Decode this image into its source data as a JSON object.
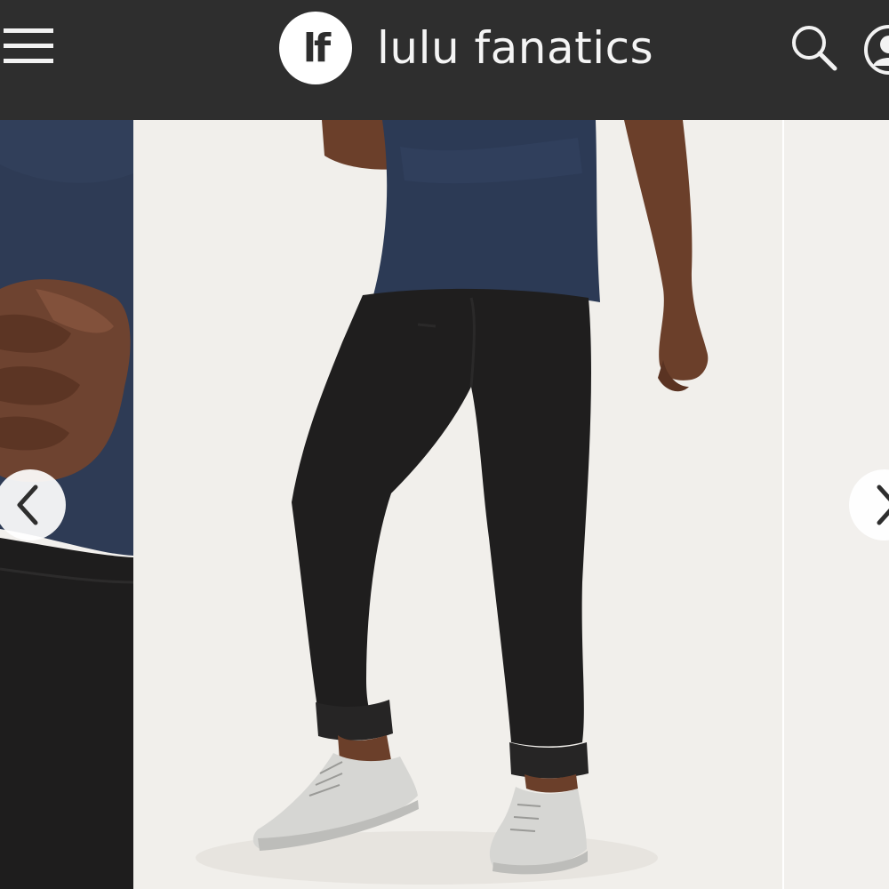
{
  "header": {
    "logo_mark": "lf",
    "brand_name": "lulu fanatics",
    "icons": {
      "menu": "hamburger-menu-icon",
      "search": "search-icon",
      "account": "account-icon"
    },
    "colors": {
      "background": "#2e2e2e",
      "foreground": "#f4f4f4"
    }
  },
  "gallery": {
    "slides": [
      {
        "position": "previous",
        "content": "close-up of hand over navy t-shirt and black pants"
      },
      {
        "position": "current",
        "content": "model wearing navy t-shirt, black cuffed pants and light grey sneakers"
      },
      {
        "position": "next",
        "content": "product image"
      }
    ],
    "controls": {
      "previous": "chevron-left-icon",
      "next": "chevron-right-icon"
    },
    "colors": {
      "backdrop": "#f1efeb",
      "shirt": "#2c3a55",
      "pants": "#1f1e1e",
      "skin": "#6b3f2a",
      "shoes": "#d6d6d3"
    }
  }
}
